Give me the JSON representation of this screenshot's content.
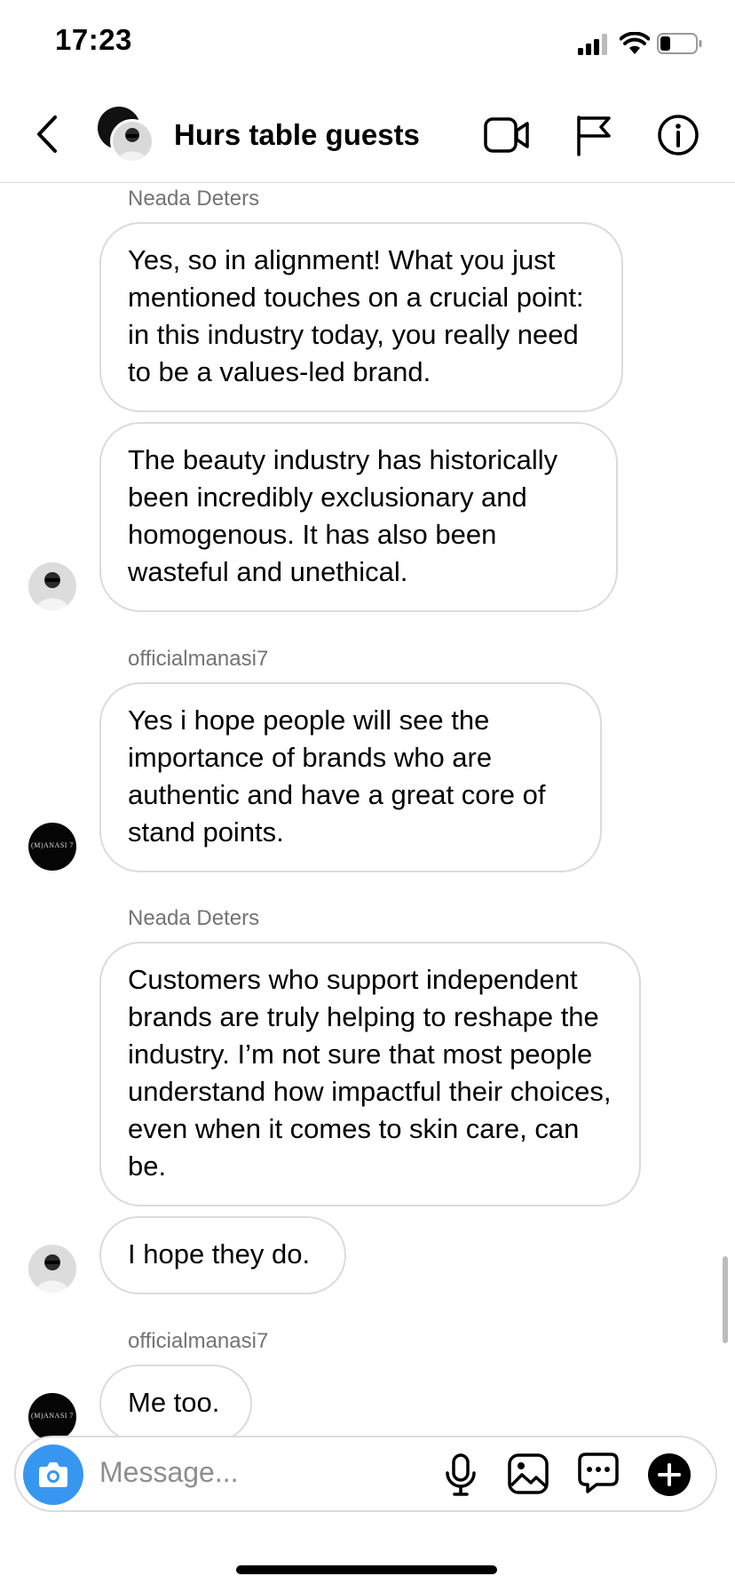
{
  "status_bar": {
    "time": "17:23"
  },
  "header": {
    "title": "Hurs table guests"
  },
  "messages": [
    {
      "sender": "Neada Deters"
    },
    {
      "text": "Yes, so in alignment! What you just mentioned touches on a crucial point: in this industry today, you really need to be a values-led brand."
    },
    {
      "text": "The beauty industry has historically been incredibly exclusionary and homogenous. It has also been wasteful and unethical."
    },
    {
      "sender": "officialmanasi7"
    },
    {
      "text": "Yes i hope people will see the importance of brands who are authentic and have a great core of stand points."
    },
    {
      "sender": "Neada Deters"
    },
    {
      "text": "Customers who support independent brands are truly helping to reshape the industry. I’m not sure that most people understand how impactful their choices, even when it comes to skin care, can be."
    },
    {
      "text": "I hope they do."
    },
    {
      "sender": "officialmanasi7"
    },
    {
      "text": "Me too."
    }
  ],
  "avatars": {
    "manasi_logo_text": "(M)ANASI 7"
  },
  "composer": {
    "placeholder": "Message..."
  },
  "icons": {
    "back": "chevron-left-icon",
    "video": "video-camera-icon",
    "flag": "flag-icon",
    "info": "info-icon",
    "camera": "camera-icon",
    "mic": "microphone-icon",
    "gallery": "image-icon",
    "sticker": "chat-sticker-icon",
    "plus": "plus-icon"
  },
  "colors": {
    "accent": "#3797f0",
    "bubble_border": "#dbdbdb",
    "sender": "#737373"
  }
}
